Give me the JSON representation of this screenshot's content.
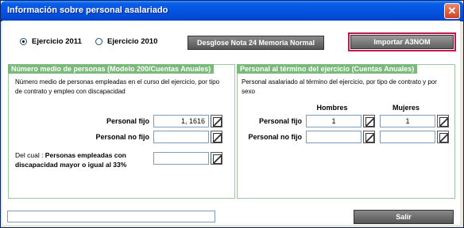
{
  "window": {
    "title": "Información sobre personal asalariado",
    "close_glyph": "✕"
  },
  "radios": [
    {
      "label": "Ejercicio 2011",
      "checked": true
    },
    {
      "label": "Ejercicio 2010",
      "checked": false
    }
  ],
  "buttons": {
    "desglose": "Desglose Nota 24 Memoria Normal",
    "importar": "Importar A3NOM",
    "salir": "Salir"
  },
  "left_panel": {
    "header": "Número medio de personas (Modelo 200/Cuentas Anuales)",
    "description": "Número medio de personas empleadas en el curso del ejercicio, por tipo de contrato y empleo con discapacidad",
    "personal_fijo_label": "Personal fijo",
    "personal_fijo_value": "1, 1616",
    "personal_no_fijo_label": "Personal no fijo",
    "personal_no_fijo_value": "",
    "discapacidad_prefix": "Del cual : ",
    "discapacidad_label": "Personas empleadas con discapacidad mayor o igual al 33%",
    "discapacidad_value": ""
  },
  "right_panel": {
    "header": "Personal al término del ejercicio (Cuentas Anuales)",
    "description": "Personal asalariado al término del ejercicio, por tipo de contrato y por sexo",
    "col_hombres": "Hombres",
    "col_mujeres": "Mujeres",
    "personal_fijo_label": "Personal fijo",
    "personal_no_fijo_label": "Personal no fijo",
    "fijo_hombres": "1",
    "fijo_mujeres": "1",
    "nofijo_hombres": "",
    "nofijo_mujeres": ""
  }
}
